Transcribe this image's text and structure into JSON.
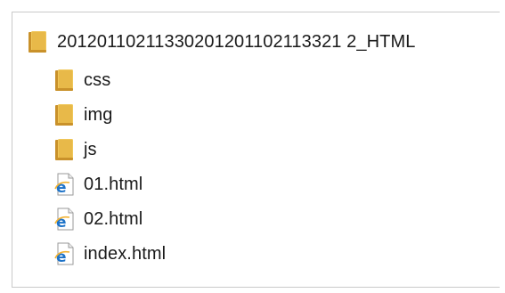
{
  "tree": {
    "root": {
      "label": "20120110211330201201102113321 2_HTML",
      "icon": "folder-icon"
    },
    "children": [
      {
        "label": "css",
        "icon": "folder-icon"
      },
      {
        "label": "img",
        "icon": "folder-icon"
      },
      {
        "label": "js",
        "icon": "folder-icon"
      },
      {
        "label": "01.html",
        "icon": "ie-html-file-icon"
      },
      {
        "label": "02.html",
        "icon": "ie-html-file-icon"
      },
      {
        "label": "index.html",
        "icon": "ie-html-file-icon"
      }
    ]
  },
  "colors": {
    "folder_body": "#e8b949",
    "folder_dark": "#c9912a",
    "ie_blue": "#1e73c8",
    "ie_ring": "#f2b233"
  }
}
